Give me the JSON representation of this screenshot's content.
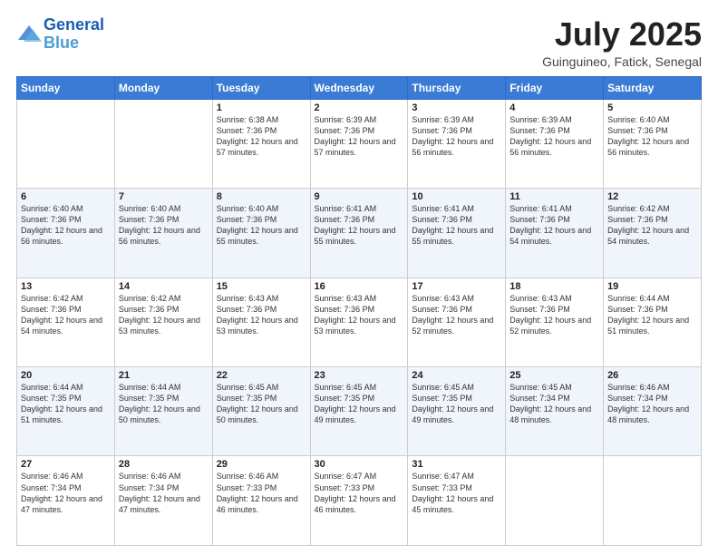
{
  "header": {
    "logo_line1": "General",
    "logo_line2": "Blue",
    "month": "July 2025",
    "location": "Guinguineo, Fatick, Senegal"
  },
  "days_of_week": [
    "Sunday",
    "Monday",
    "Tuesday",
    "Wednesday",
    "Thursday",
    "Friday",
    "Saturday"
  ],
  "weeks": [
    [
      {
        "day": "",
        "info": ""
      },
      {
        "day": "",
        "info": ""
      },
      {
        "day": "1",
        "info": "Sunrise: 6:38 AM\nSunset: 7:36 PM\nDaylight: 12 hours and 57 minutes."
      },
      {
        "day": "2",
        "info": "Sunrise: 6:39 AM\nSunset: 7:36 PM\nDaylight: 12 hours and 57 minutes."
      },
      {
        "day": "3",
        "info": "Sunrise: 6:39 AM\nSunset: 7:36 PM\nDaylight: 12 hours and 56 minutes."
      },
      {
        "day": "4",
        "info": "Sunrise: 6:39 AM\nSunset: 7:36 PM\nDaylight: 12 hours and 56 minutes."
      },
      {
        "day": "5",
        "info": "Sunrise: 6:40 AM\nSunset: 7:36 PM\nDaylight: 12 hours and 56 minutes."
      }
    ],
    [
      {
        "day": "6",
        "info": "Sunrise: 6:40 AM\nSunset: 7:36 PM\nDaylight: 12 hours and 56 minutes."
      },
      {
        "day": "7",
        "info": "Sunrise: 6:40 AM\nSunset: 7:36 PM\nDaylight: 12 hours and 56 minutes."
      },
      {
        "day": "8",
        "info": "Sunrise: 6:40 AM\nSunset: 7:36 PM\nDaylight: 12 hours and 55 minutes."
      },
      {
        "day": "9",
        "info": "Sunrise: 6:41 AM\nSunset: 7:36 PM\nDaylight: 12 hours and 55 minutes."
      },
      {
        "day": "10",
        "info": "Sunrise: 6:41 AM\nSunset: 7:36 PM\nDaylight: 12 hours and 55 minutes."
      },
      {
        "day": "11",
        "info": "Sunrise: 6:41 AM\nSunset: 7:36 PM\nDaylight: 12 hours and 54 minutes."
      },
      {
        "day": "12",
        "info": "Sunrise: 6:42 AM\nSunset: 7:36 PM\nDaylight: 12 hours and 54 minutes."
      }
    ],
    [
      {
        "day": "13",
        "info": "Sunrise: 6:42 AM\nSunset: 7:36 PM\nDaylight: 12 hours and 54 minutes."
      },
      {
        "day": "14",
        "info": "Sunrise: 6:42 AM\nSunset: 7:36 PM\nDaylight: 12 hours and 53 minutes."
      },
      {
        "day": "15",
        "info": "Sunrise: 6:43 AM\nSunset: 7:36 PM\nDaylight: 12 hours and 53 minutes."
      },
      {
        "day": "16",
        "info": "Sunrise: 6:43 AM\nSunset: 7:36 PM\nDaylight: 12 hours and 53 minutes."
      },
      {
        "day": "17",
        "info": "Sunrise: 6:43 AM\nSunset: 7:36 PM\nDaylight: 12 hours and 52 minutes."
      },
      {
        "day": "18",
        "info": "Sunrise: 6:43 AM\nSunset: 7:36 PM\nDaylight: 12 hours and 52 minutes."
      },
      {
        "day": "19",
        "info": "Sunrise: 6:44 AM\nSunset: 7:36 PM\nDaylight: 12 hours and 51 minutes."
      }
    ],
    [
      {
        "day": "20",
        "info": "Sunrise: 6:44 AM\nSunset: 7:35 PM\nDaylight: 12 hours and 51 minutes."
      },
      {
        "day": "21",
        "info": "Sunrise: 6:44 AM\nSunset: 7:35 PM\nDaylight: 12 hours and 50 minutes."
      },
      {
        "day": "22",
        "info": "Sunrise: 6:45 AM\nSunset: 7:35 PM\nDaylight: 12 hours and 50 minutes."
      },
      {
        "day": "23",
        "info": "Sunrise: 6:45 AM\nSunset: 7:35 PM\nDaylight: 12 hours and 49 minutes."
      },
      {
        "day": "24",
        "info": "Sunrise: 6:45 AM\nSunset: 7:35 PM\nDaylight: 12 hours and 49 minutes."
      },
      {
        "day": "25",
        "info": "Sunrise: 6:45 AM\nSunset: 7:34 PM\nDaylight: 12 hours and 48 minutes."
      },
      {
        "day": "26",
        "info": "Sunrise: 6:46 AM\nSunset: 7:34 PM\nDaylight: 12 hours and 48 minutes."
      }
    ],
    [
      {
        "day": "27",
        "info": "Sunrise: 6:46 AM\nSunset: 7:34 PM\nDaylight: 12 hours and 47 minutes."
      },
      {
        "day": "28",
        "info": "Sunrise: 6:46 AM\nSunset: 7:34 PM\nDaylight: 12 hours and 47 minutes."
      },
      {
        "day": "29",
        "info": "Sunrise: 6:46 AM\nSunset: 7:33 PM\nDaylight: 12 hours and 46 minutes."
      },
      {
        "day": "30",
        "info": "Sunrise: 6:47 AM\nSunset: 7:33 PM\nDaylight: 12 hours and 46 minutes."
      },
      {
        "day": "31",
        "info": "Sunrise: 6:47 AM\nSunset: 7:33 PM\nDaylight: 12 hours and 45 minutes."
      },
      {
        "day": "",
        "info": ""
      },
      {
        "day": "",
        "info": ""
      }
    ]
  ]
}
